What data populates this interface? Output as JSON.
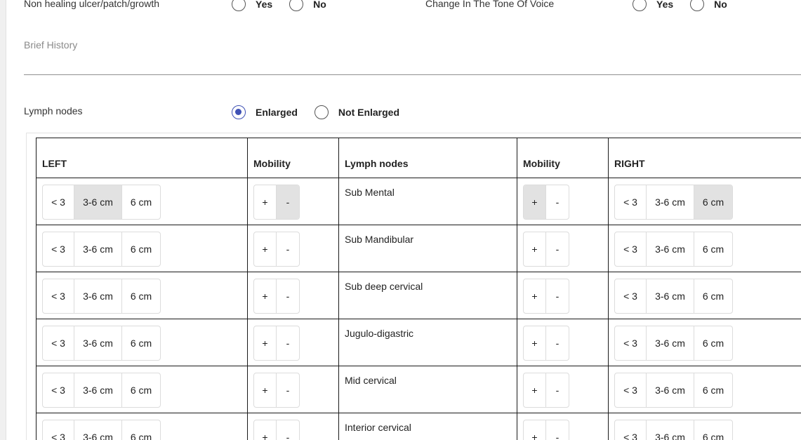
{
  "top_row": {
    "left_question": "Non healing ulcer/patch/growth",
    "right_question": "Change In The Tone Of Voice",
    "yes_label": "Yes",
    "no_label": "No"
  },
  "brief_history": {
    "label": "Brief History",
    "value": ""
  },
  "lymph_section": {
    "label": "Lymph nodes",
    "options": [
      "Enlarged",
      "Not Enlarged"
    ],
    "selected": "Enlarged"
  },
  "table": {
    "headers": [
      "LEFT",
      "Mobility",
      "Lymph nodes",
      "Mobility",
      "RIGHT"
    ],
    "size_options": [
      "< 3",
      "3-6 cm",
      "6 cm"
    ],
    "mobility_options": [
      "+",
      "-"
    ],
    "rows": [
      {
        "name": "Sub Mental",
        "left_size": "3-6 cm",
        "left_mobility": "-",
        "right_mobility": "+",
        "right_size": "6 cm"
      },
      {
        "name": "Sub Mandibular",
        "left_size": "",
        "left_mobility": "",
        "right_mobility": "",
        "right_size": ""
      },
      {
        "name": "Sub deep cervical",
        "left_size": "",
        "left_mobility": "",
        "right_mobility": "",
        "right_size": ""
      },
      {
        "name": "Jugulo-digastric",
        "left_size": "",
        "left_mobility": "",
        "right_mobility": "",
        "right_size": ""
      },
      {
        "name": "Mid cervical",
        "left_size": "",
        "left_mobility": "",
        "right_mobility": "",
        "right_size": ""
      },
      {
        "name": "Interior cervical",
        "left_size": "",
        "left_mobility": "",
        "right_mobility": "",
        "right_size": ""
      }
    ]
  }
}
